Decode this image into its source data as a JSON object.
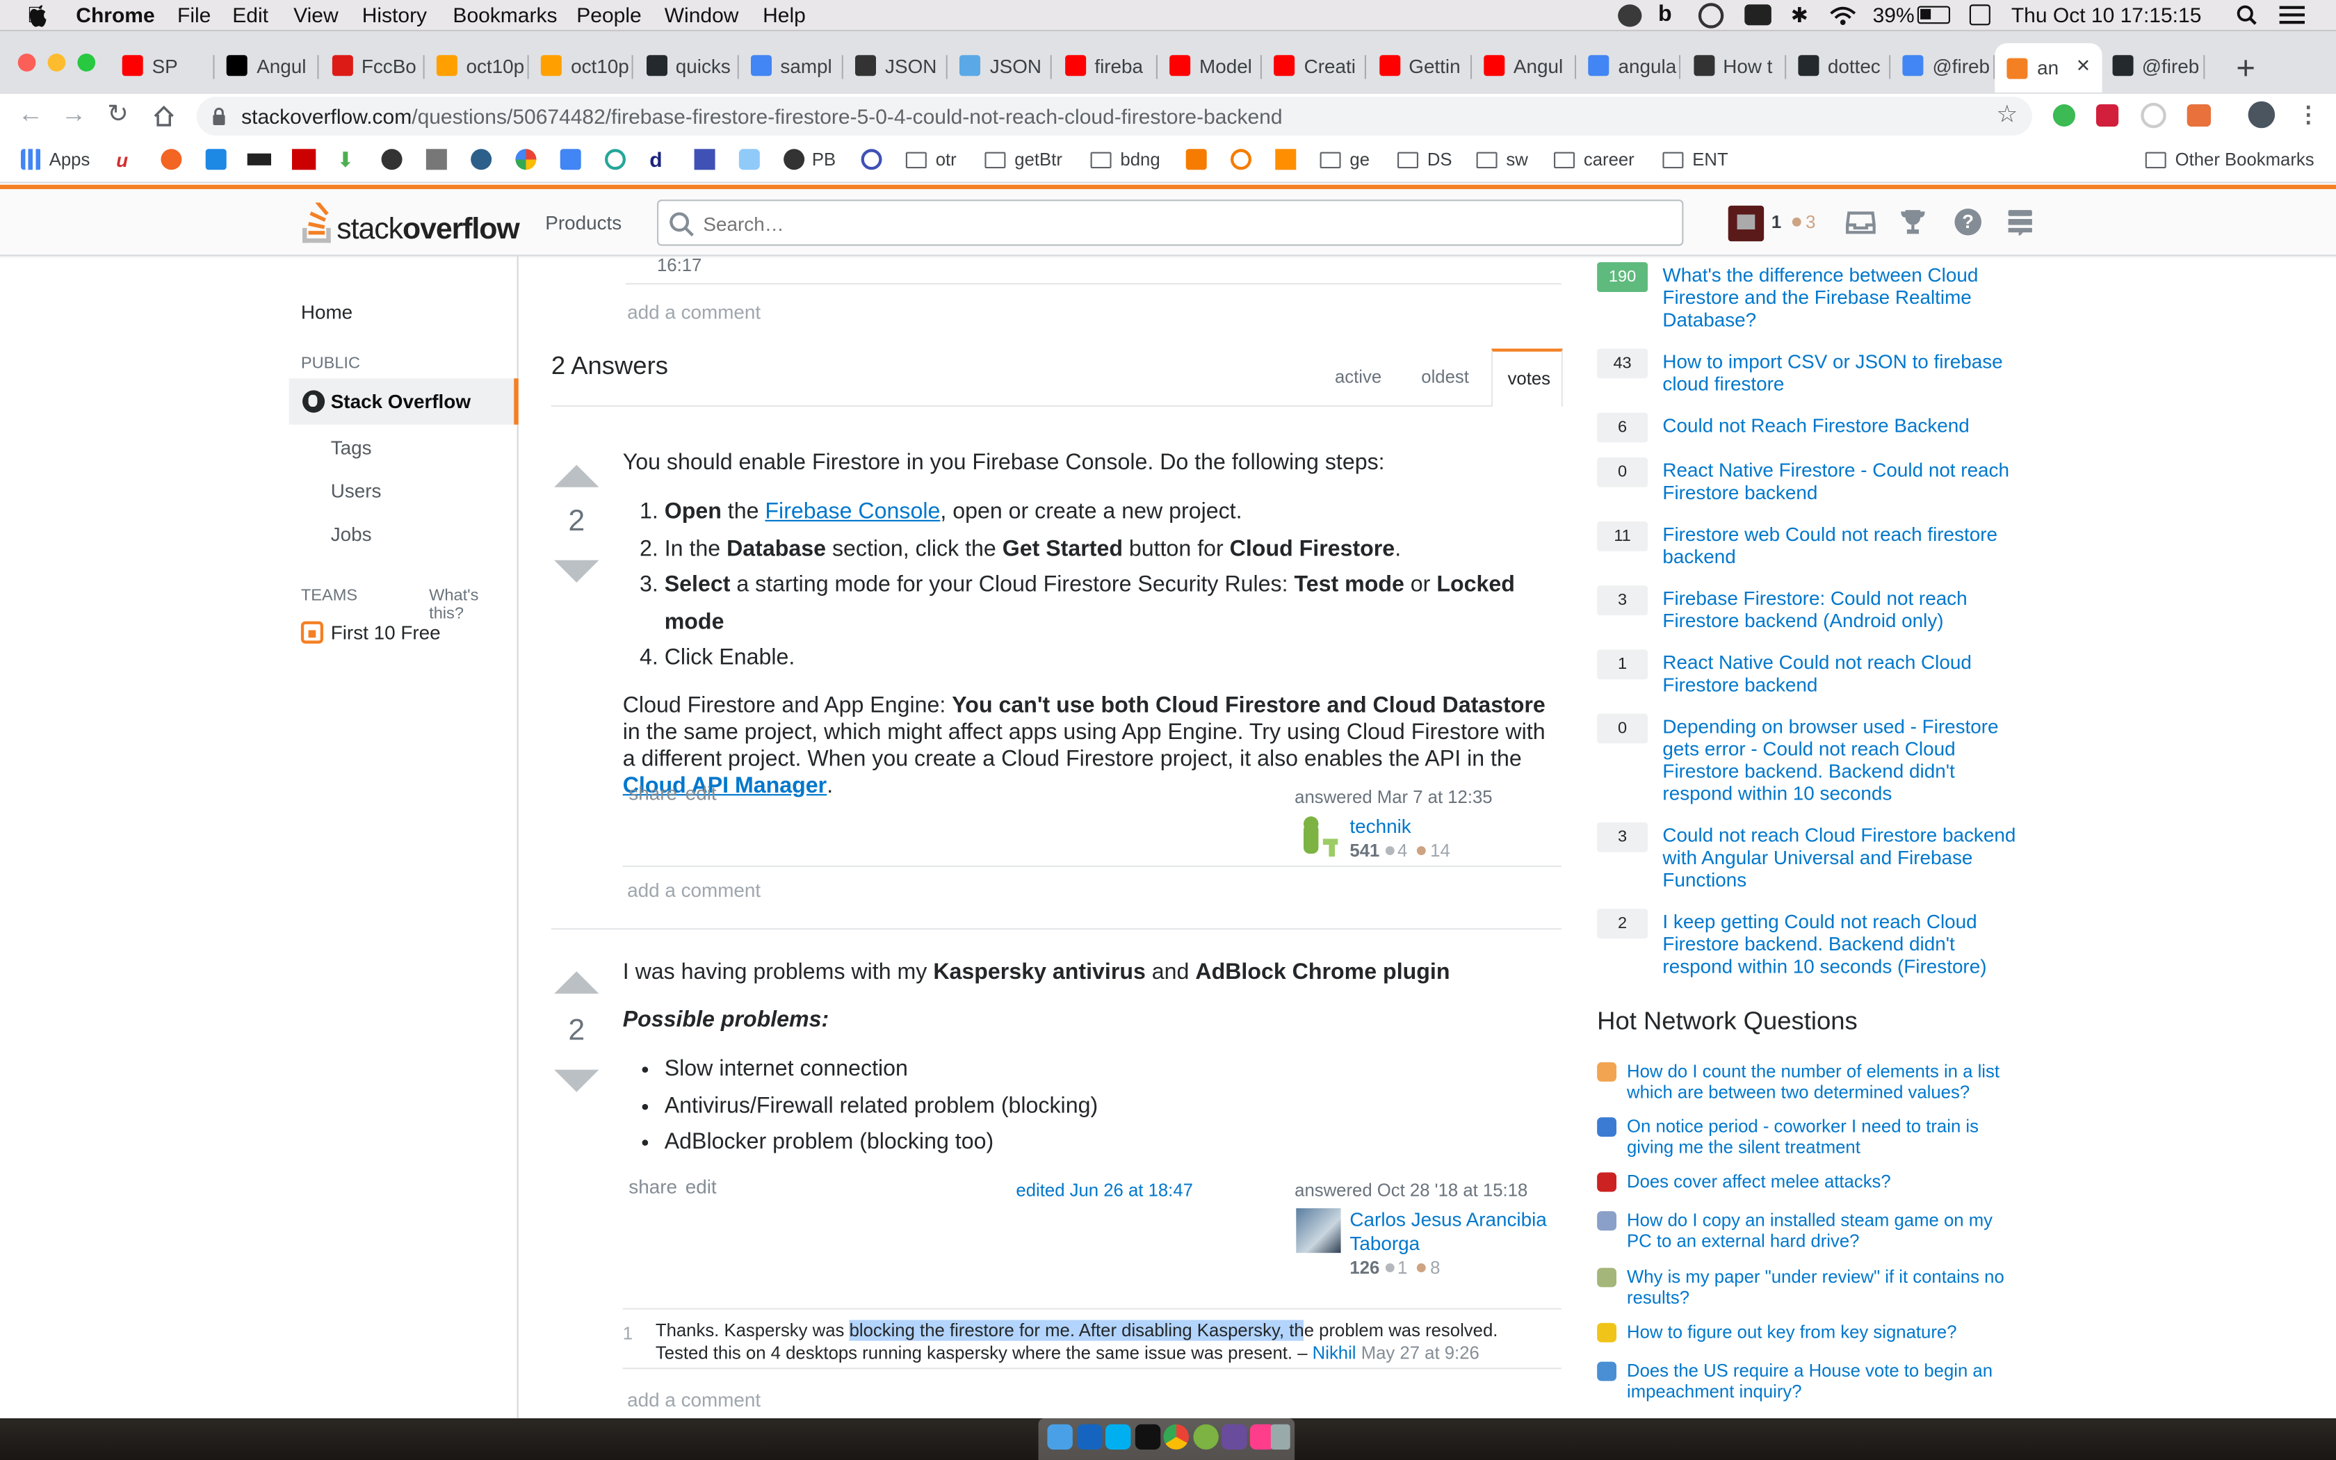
{
  "menubar": {
    "app": "Chrome",
    "items": [
      "File",
      "Edit",
      "View",
      "History",
      "Bookmarks",
      "People",
      "Window",
      "Help"
    ],
    "battery": "39%",
    "datetime": "Thu Oct 10  17:15:15"
  },
  "tabs": [
    {
      "label": "SP",
      "color": "#ff0000"
    },
    {
      "label": "Angul",
      "color": "#000000"
    },
    {
      "label": "FccBo",
      "color": "#dd1b16"
    },
    {
      "label": "oct10p",
      "color": "#ffa000"
    },
    {
      "label": "oct10p",
      "color": "#ffa000"
    },
    {
      "label": "quicks",
      "color": "#24292e"
    },
    {
      "label": "sampl",
      "color": "#4285f4"
    },
    {
      "label": "JSON",
      "color": "#333333"
    },
    {
      "label": "JSON",
      "color": "#5aa9e6"
    },
    {
      "label": "fireba",
      "color": "#ff0000"
    },
    {
      "label": "Model",
      "color": "#ff0000"
    },
    {
      "label": "Creati",
      "color": "#ff0000"
    },
    {
      "label": "Gettin",
      "color": "#ff0000"
    },
    {
      "label": "Angul",
      "color": "#ff0000"
    },
    {
      "label": "angula",
      "color": "#4285f4"
    },
    {
      "label": "How t",
      "color": "#333333"
    },
    {
      "label": "dottec",
      "color": "#24292e"
    },
    {
      "label": "@fireb",
      "color": "#4285f4"
    },
    {
      "label": "an",
      "color": "#f48024"
    },
    {
      "label": "@fireb",
      "color": "#24292e"
    }
  ],
  "url": {
    "host": "stackoverflow.com",
    "path": "/questions/50674482/firebase-firestore-firestore-5-0-4-could-not-reach-cloud-firestore-backend"
  },
  "bookmarks": {
    "apps": "Apps",
    "items": [
      "PB",
      "otr",
      "getBtr",
      "bdng",
      "ge",
      "DS",
      "sw",
      "career",
      "ENT"
    ],
    "other": "Other Bookmarks"
  },
  "header": {
    "logo_a": "stack",
    "logo_b": "overflow",
    "products": "Products",
    "search_placeholder": "Search…",
    "rep": "1",
    "bronze": "3"
  },
  "leftnav": {
    "home": "Home",
    "public": "PUBLIC",
    "stack_overflow": "Stack Overflow",
    "tags": "Tags",
    "users": "Users",
    "jobs": "Jobs",
    "teams": "TEAMS",
    "whats_this": "What's this?",
    "first_free": "First 10 Free"
  },
  "question_tail": {
    "time": "16:17",
    "add_comment": "add a comment"
  },
  "answers_header": {
    "title": "2 Answers",
    "tabs": [
      "active",
      "oldest",
      "votes"
    ]
  },
  "answer1": {
    "votes": "2",
    "intro": "You should enable Firestore in you Firebase Console. Do the following steps:",
    "s1_b": "Open",
    "s1_a": " the ",
    "s1_link": "Firebase Console",
    "s1_c": ", open or create a new project.",
    "s2_a": "In the ",
    "s2_b": "Database",
    "s2_c": " section, click the ",
    "s2_d": "Get Started",
    "s2_e": " button for ",
    "s2_f": "Cloud Firestore",
    "s2_g": ".",
    "s3_b": "Select",
    "s3_a": " a starting mode for your Cloud Firestore Security Rules: ",
    "s3_c": "Test mode",
    "s3_d": " or ",
    "s3_e": "Locked mode",
    "s4": "Click Enable.",
    "p2_a": "Cloud Firestore and App Engine: ",
    "p2_b": "You can't use both Cloud Firestore and Cloud Datastore",
    "p2_c": " in the same project, which might affect apps using App Engine. Try using Cloud Firestore with a different project. When you create a Cloud Firestore project, it also enables the API in the ",
    "p2_link": "Cloud API Manager",
    "p2_d": ".",
    "share": "share",
    "edit": "edit",
    "answered": "answered Mar 7 at 12:35",
    "user": "technik",
    "rep": "541",
    "silver": "4",
    "bronze": "14",
    "add_comment": "add a comment"
  },
  "answer2": {
    "votes": "2",
    "intro_a": "I was having problems with my ",
    "intro_b": "Kaspersky antivirus",
    "intro_c": " and ",
    "intro_d": "AdBlock Chrome plugin",
    "possible": "Possible problems:",
    "bullets": [
      "Slow internet connection",
      "Antivirus/Firewall related problem (blocking)",
      "AdBlocker problem (blocking too)"
    ],
    "share": "share",
    "edit": "edit",
    "edited": "edited Jun 26 at 18:47",
    "answered": "answered Oct 28 '18 at 15:18",
    "user": "Carlos Jesus Arancibia Taborga",
    "rep": "126",
    "silver": "1",
    "bronze": "8",
    "comment_score": "1",
    "comment_a": "Thanks. Kaspersky was ",
    "comment_hl": "blocking the firestore for me. After disabling Kaspersky, th",
    "comment_b": "e problem was resolved. Tested this on 4 desktops running kaspersky where the same issue was present. – ",
    "comment_user": "Nikhil",
    "comment_date": "May 27 at 9:26",
    "add_comment": "add a comment"
  },
  "related": [
    {
      "score": "190",
      "title": "What's the difference between Cloud Firestore and the Firebase Realtime Database?",
      "accepted": true
    },
    {
      "score": "43",
      "title": "How to import CSV or JSON to firebase cloud firestore",
      "accepted": false
    },
    {
      "score": "6",
      "title": "Could not Reach Firestore Backend",
      "accepted": false
    },
    {
      "score": "0",
      "title": "React Native Firestore - Could not reach Firestore backend",
      "accepted": false
    },
    {
      "score": "11",
      "title": "Firestore web Could not reach firestore backend",
      "accepted": false
    },
    {
      "score": "3",
      "title": "Firebase Firestore: Could not reach Firestore backend (Android only)",
      "accepted": false
    },
    {
      "score": "1",
      "title": "React Native Could not reach Cloud Firestore backend",
      "accepted": false
    },
    {
      "score": "0",
      "title": "Depending on browser used - Firestore gets error - Could not reach Cloud Firestore backend. Backend didn't respond within 10 seconds",
      "accepted": false
    },
    {
      "score": "3",
      "title": "Could not reach Cloud Firestore backend with Angular Universal and Firebase Functions",
      "accepted": false
    },
    {
      "score": "2",
      "title": "I keep getting Could not reach Cloud Firestore backend. Backend didn't respond within 10 seconds (Firestore)",
      "accepted": false
    }
  ],
  "hnq": {
    "title": "Hot Network Questions",
    "items": [
      {
        "title": "How do I count the number of elements in a list which are between two determined values?",
        "color": "#f2a451"
      },
      {
        "title": "On notice period - coworker I need to train is giving me the silent treatment",
        "color": "#3b7bd4"
      },
      {
        "title": "Does cover affect melee attacks?",
        "color": "#c22"
      },
      {
        "title": "How do I copy an installed steam game on my PC to an external hard drive?",
        "color": "#8aa0c8"
      },
      {
        "title": "Why is my paper \"under review\" if it contains no results?",
        "color": "#a4b67a"
      },
      {
        "title": "How to figure out key from key signature?",
        "color": "#f0c419"
      },
      {
        "title": "Does the US require a House vote to begin an impeachment inquiry?",
        "color": "#4a8fd4"
      }
    ]
  }
}
